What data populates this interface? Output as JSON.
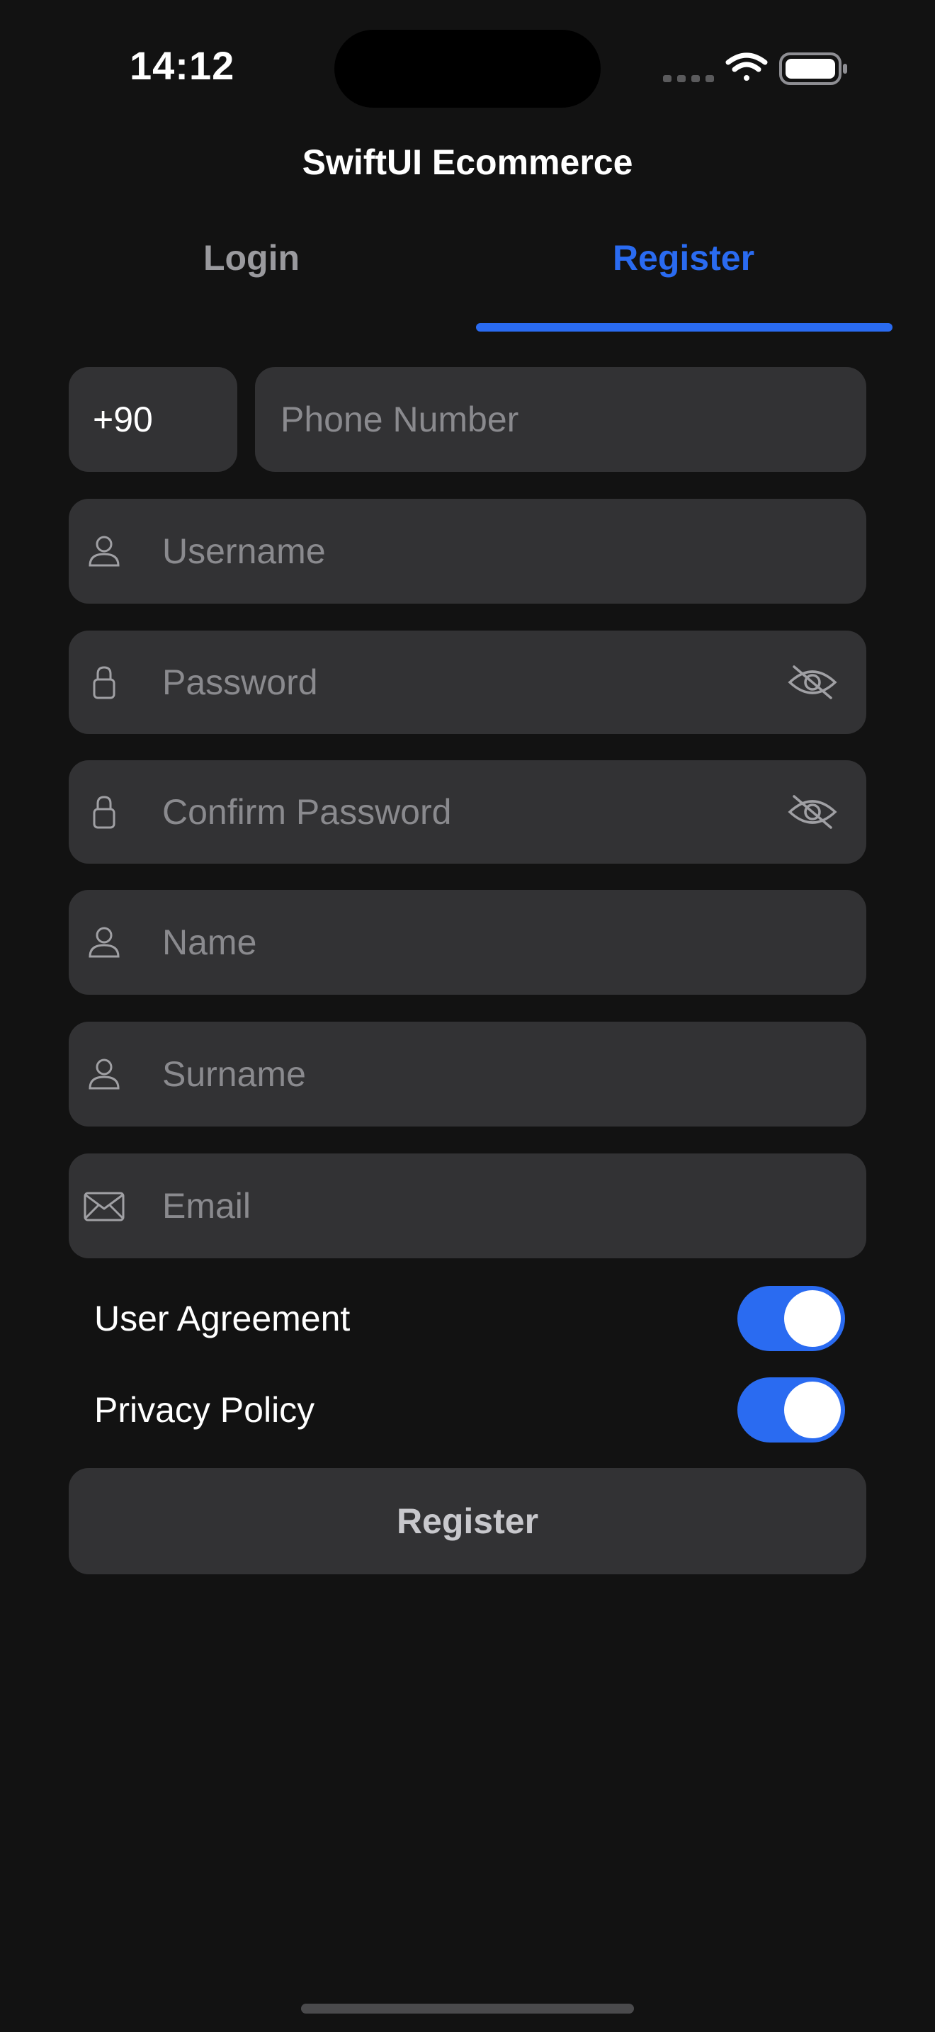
{
  "status_bar": {
    "time": "14:12"
  },
  "nav": {
    "title": "SwiftUI Ecommerce"
  },
  "tabs": [
    {
      "label": "Login",
      "selected": false
    },
    {
      "label": "Register",
      "selected": true
    }
  ],
  "form": {
    "country_code": "+90",
    "phone_placeholder": "Phone Number",
    "username_placeholder": "Username",
    "password_placeholder": "Password",
    "confirm_password_placeholder": "Confirm Password",
    "name_placeholder": "Name",
    "surname_placeholder": "Surname",
    "email_placeholder": "Email"
  },
  "toggles": [
    {
      "label": "User Agreement",
      "on": true
    },
    {
      "label": "Privacy Policy",
      "on": true
    }
  ],
  "actions": {
    "register_label": "Register"
  },
  "colors": {
    "background": "#121212",
    "field": "#323234",
    "accent": "#2a6bf1",
    "placeholder": "#8a8a8e"
  },
  "icons": [
    "wifi-icon",
    "battery-icon",
    "cellular-icon",
    "person-icon",
    "lock-icon",
    "eye-slash-icon",
    "envelope-icon"
  ]
}
